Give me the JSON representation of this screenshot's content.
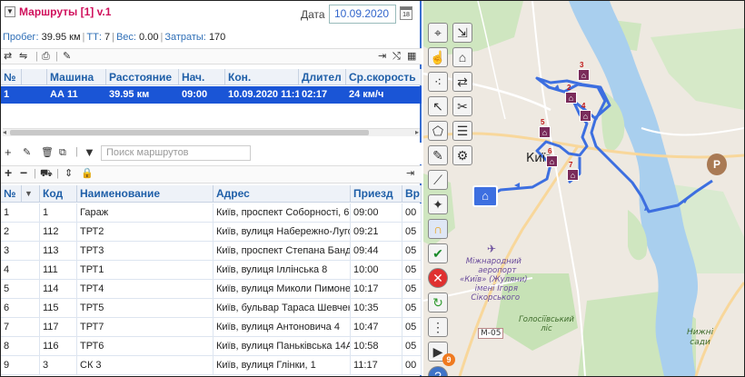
{
  "header": {
    "title": "Маршруты [1]  v.1",
    "date_label": "Дата",
    "date_value": "10.09.2020",
    "calendar_number": "18"
  },
  "stats": {
    "distance_label": "Пробег:",
    "distance_value": "39.95 км",
    "tt_label": "ТТ:",
    "tt_value": "7",
    "weight_label": "Вес:",
    "weight_value": "0.00",
    "cost_label": "Затраты:",
    "cost_value": "170"
  },
  "routes_table": {
    "columns": [
      "№",
      "Машина",
      "Расстояние",
      "Нач.",
      "Кон.",
      "Длител",
      "Ср.скорость"
    ],
    "rows": [
      [
        "1",
        "АА 11",
        "39.95 км",
        "09:00",
        "10.09.2020 11:1",
        "02:17",
        "24 км/ч"
      ]
    ]
  },
  "search": {
    "placeholder": "Поиск маршрутов"
  },
  "points_table": {
    "columns": [
      "№",
      "Код",
      "Наименование",
      "Адрес",
      "Приезд",
      "Вр"
    ],
    "rows": [
      [
        "1",
        "1",
        "Гараж",
        "Київ, проспект Соборності, 6",
        "09:00",
        "00"
      ],
      [
        "2",
        "112",
        "ТРТ2",
        "Київ, вулиця Набережно-Луговa",
        "09:21",
        "05"
      ],
      [
        "3",
        "113",
        "ТРТ3",
        "Київ, проспект Степана Банде",
        "09:44",
        "05"
      ],
      [
        "4",
        "111",
        "ТРТ1",
        "Київ, вулиця Іллінська 8",
        "10:00",
        "05"
      ],
      [
        "5",
        "114",
        "ТРТ4",
        "Київ, вулиця Миколи Пимонен",
        "10:17",
        "05"
      ],
      [
        "6",
        "115",
        "ТРТ5",
        "Київ, бульвар Тараса Шевченк",
        "10:35",
        "05"
      ],
      [
        "7",
        "117",
        "ТРТ7",
        "Київ, вулиця Антоновича 4",
        "10:47",
        "05"
      ],
      [
        "8",
        "116",
        "ТРТ6",
        "Київ, вулиця Паньківська 14А",
        "10:58",
        "05"
      ],
      [
        "9",
        "3",
        "СК 3",
        "Київ, вулиця Глінки, 1",
        "11:17",
        "00"
      ]
    ]
  },
  "map": {
    "city_label": "Київ",
    "airport_label_1": "Міжнародний",
    "airport_label_2": "аеропорт",
    "airport_label_3": "«Київ» (Жуляни)",
    "airport_label_4": "імені Ігоря",
    "airport_label_5": "Сікорського",
    "forest_label_1": "Голосіївський",
    "forest_label_2": "ліс",
    "road_label": "М-05",
    "garden_label_1": "Нижні",
    "garden_label_2": "сади",
    "markers": [
      "2",
      "3",
      "4",
      "5",
      "6",
      "7"
    ],
    "badge_count": "9",
    "route_color": "#3d6fe0",
    "marker_color": "#7a2b5a"
  }
}
